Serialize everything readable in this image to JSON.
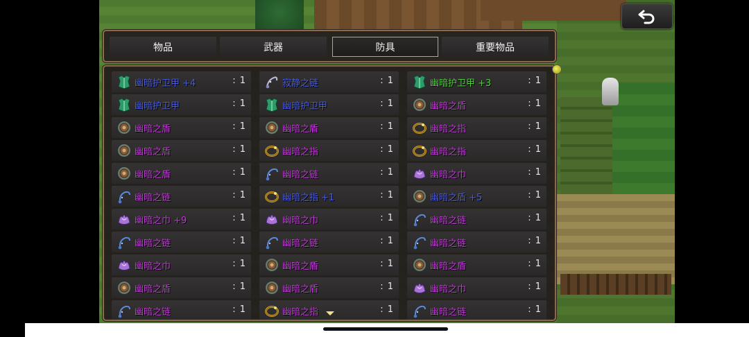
{
  "tabs": [
    {
      "label": "物品",
      "active": false
    },
    {
      "label": "武器",
      "active": false
    },
    {
      "label": "防具",
      "active": true
    },
    {
      "label": "重要物品",
      "active": false
    }
  ],
  "back_button": {
    "icon": "return-arrow-icon"
  },
  "item_columns": [
    [
      {
        "name": "幽暗护卫甲 +4",
        "count": ": 1",
        "color": "blue",
        "icon": "armor"
      },
      {
        "name": "幽暗护卫甲",
        "count": ": 1",
        "color": "blue",
        "icon": "armor"
      },
      {
        "name": "幽暗之盾",
        "count": ": 1",
        "color": "magenta",
        "icon": "shield"
      },
      {
        "name": "幽暗之盾",
        "count": ": 1",
        "color": "magenta",
        "icon": "shield"
      },
      {
        "name": "幽暗之盾",
        "count": ": 1",
        "color": "magenta",
        "icon": "shield"
      },
      {
        "name": "幽暗之链",
        "count": ": 1",
        "color": "magenta",
        "icon": "chain"
      },
      {
        "name": "幽暗之巾 +9",
        "count": ": 1",
        "color": "magenta",
        "icon": "scarf"
      },
      {
        "name": "幽暗之链",
        "count": ": 1",
        "color": "magenta",
        "icon": "chain"
      },
      {
        "name": "幽暗之巾",
        "count": ": 1",
        "color": "magenta",
        "icon": "scarf"
      },
      {
        "name": "幽暗之盾",
        "count": ": 1",
        "color": "magenta",
        "icon": "shield"
      },
      {
        "name": "幽暗之链",
        "count": ": 1",
        "color": "magenta",
        "icon": "chain"
      }
    ],
    [
      {
        "name": "寂静之链",
        "count": ": 1",
        "color": "blue",
        "icon": "chain-silver"
      },
      {
        "name": "幽暗护卫甲",
        "count": ": 1",
        "color": "blue",
        "icon": "armor"
      },
      {
        "name": "幽暗之盾",
        "count": ": 1",
        "color": "magenta",
        "icon": "shield"
      },
      {
        "name": "幽暗之指",
        "count": ": 1",
        "color": "magenta",
        "icon": "ring"
      },
      {
        "name": "幽暗之链",
        "count": ": 1",
        "color": "magenta",
        "icon": "chain"
      },
      {
        "name": "幽暗之指 +1",
        "count": ": 1",
        "color": "blue",
        "icon": "ring"
      },
      {
        "name": "幽暗之巾",
        "count": ": 1",
        "color": "magenta",
        "icon": "scarf"
      },
      {
        "name": "幽暗之链",
        "count": ": 1",
        "color": "magenta",
        "icon": "chain"
      },
      {
        "name": "幽暗之盾",
        "count": ": 1",
        "color": "magenta",
        "icon": "shield"
      },
      {
        "name": "幽暗之盾",
        "count": ": 1",
        "color": "magenta",
        "icon": "shield"
      },
      {
        "name": "幽暗之指",
        "count": ": 1",
        "color": "magenta",
        "icon": "ring"
      }
    ],
    [
      {
        "name": "幽暗护卫甲 +3",
        "count": ": 1",
        "color": "green",
        "icon": "armor"
      },
      {
        "name": "幽暗之盾",
        "count": ": 1",
        "color": "magenta",
        "icon": "shield"
      },
      {
        "name": "幽暗之指",
        "count": ": 1",
        "color": "magenta",
        "icon": "ring"
      },
      {
        "name": "幽暗之指",
        "count": ": 1",
        "color": "magenta",
        "icon": "ring"
      },
      {
        "name": "幽暗之巾",
        "count": ": 1",
        "color": "magenta",
        "icon": "scarf"
      },
      {
        "name": "幽暗之盾 +5",
        "count": ": 1",
        "color": "blue",
        "icon": "shield"
      },
      {
        "name": "幽暗之链",
        "count": ": 1",
        "color": "magenta",
        "icon": "chain"
      },
      {
        "name": "幽暗之链",
        "count": ": 1",
        "color": "magenta",
        "icon": "chain"
      },
      {
        "name": "幽暗之盾",
        "count": ": 1",
        "color": "magenta",
        "icon": "shield"
      },
      {
        "name": "幽暗之巾",
        "count": ": 1",
        "color": "magenta",
        "icon": "scarf"
      },
      {
        "name": "幽暗之链",
        "count": ": 1",
        "color": "magenta",
        "icon": "chain"
      }
    ]
  ],
  "colors": {
    "blue": "#4b5ee0",
    "magenta": "#c23bd8",
    "green": "#4fd23e",
    "panel_border": "#8a6a4a",
    "active_tab_border": "#c6a85a"
  }
}
